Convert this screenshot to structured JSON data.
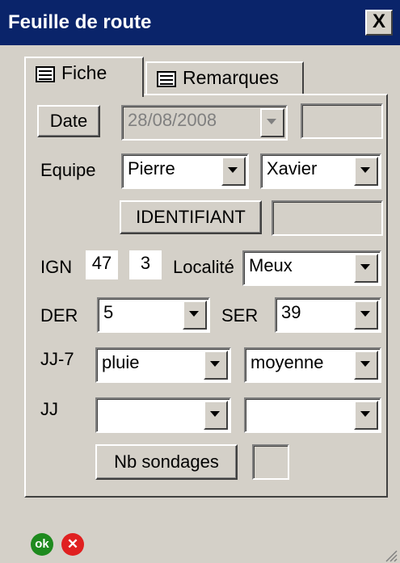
{
  "window": {
    "title": "Feuille de route",
    "close_symbol": "X"
  },
  "tabs": [
    {
      "label": "Fiche"
    },
    {
      "label": "Remarques"
    }
  ],
  "date": {
    "button_label": "Date",
    "value": "28/08/2008"
  },
  "equipe": {
    "label": "Equipe",
    "member1": "Pierre",
    "member2": "Xavier"
  },
  "identifiant": {
    "button_label": "IDENTIFIANT"
  },
  "ign": {
    "label": "IGN",
    "value1": "47",
    "value2": "3"
  },
  "localite": {
    "label": "Localité",
    "value": "Meux"
  },
  "der": {
    "label": "DER",
    "value": "5"
  },
  "ser": {
    "label": "SER",
    "value": "39"
  },
  "jj7": {
    "label": "JJ-7",
    "weather": "pluie",
    "intensity": "moyenne"
  },
  "jj": {
    "label": "JJ",
    "weather": "",
    "intensity": ""
  },
  "sondages": {
    "button_label": "Nb sondages"
  },
  "footer": {
    "ok_label": "ok",
    "cancel_symbol": "✕",
    "ok_color": "#1e8a1e",
    "cancel_color": "#e02020"
  }
}
